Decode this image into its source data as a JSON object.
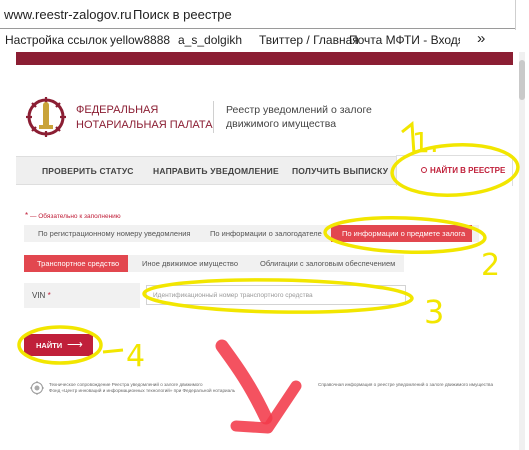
{
  "browser": {
    "url": "www.reestr-zalogov.ru",
    "page_title": "Поиск в реестре",
    "bookmarks": [
      "Настройка ссылок",
      "yellow8888",
      "a_s_dolgikh",
      "Твиттер / Главная",
      "Почта МФТИ - Входящи"
    ],
    "more_symbol": "»"
  },
  "header": {
    "org_line1": "Федеральная",
    "org_line2": "нотариальная палата",
    "registry_line1": "Реестр уведомлений о залоге",
    "registry_line2": "движимого имущества"
  },
  "nav": {
    "check_status": "ПРОВЕРИТЬ СТАТУС",
    "send_notice": "НАПРАВИТЬ УВЕДОМЛЕНИЕ",
    "get_extract": "ПОЛУЧИТЬ ВЫПИСКУ",
    "search_registry": "НАЙТИ В РЕЕСТРЕ"
  },
  "form": {
    "required_note": "— Обязательно к заполнению",
    "by_tabs": [
      "По регистрационному номеру уведомления",
      "По информации о залогодателе",
      "По информации о предмете залога"
    ],
    "property_tabs": [
      "Транспортное средство",
      "Иное движимое имущество",
      "Облигации с залоговым обеспечением"
    ],
    "vin_label": "VIN",
    "vin_placeholder": "Идентификационный номер транспортного средства",
    "find_button": "НАЙТИ",
    "find_arrow": "⟶"
  },
  "footer": {
    "left_line1": "Техническое сопровождение Реестра уведомлений о залоге движимого",
    "left_line2": "Фонд «Центр инноваций и информационных технологий» при Федеральной нотариаль",
    "right": "Справочная информация о реестре уведомлений о залоге движимого имущества"
  },
  "annotations": {
    "step1": "1.",
    "step2": "2",
    "step3": "3",
    "step4": "4"
  },
  "colors": {
    "brand": "#8b1e33",
    "accent_red": "#e2474f",
    "highlight_yellow": "#f2e600",
    "pen_red": "#f23a4a"
  }
}
